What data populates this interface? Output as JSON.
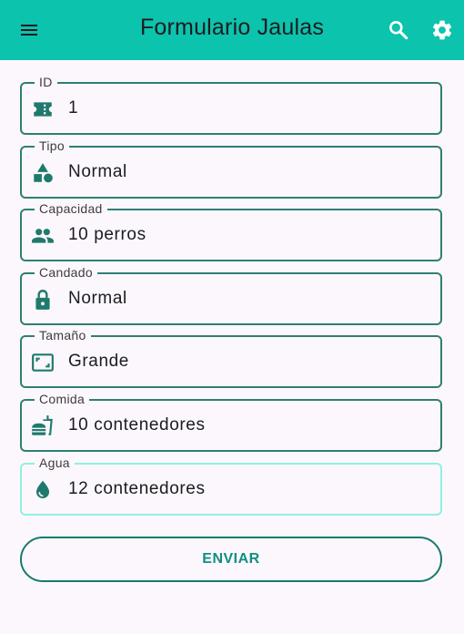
{
  "appbar": {
    "title": "Formulario Jaulas",
    "icons": {
      "menu": "menu-icon",
      "search": "search-icon",
      "settings": "gear-icon"
    }
  },
  "fields": [
    {
      "label": "ID",
      "value": "1",
      "icon": "ticket-icon"
    },
    {
      "label": "Tipo",
      "value": "Normal",
      "icon": "shapes-icon"
    },
    {
      "label": "Capacidad",
      "value": "10 perros",
      "icon": "people-icon"
    },
    {
      "label": "Candado",
      "value": "Normal",
      "icon": "lock-icon"
    },
    {
      "label": "Tamaño",
      "value": "Grande",
      "icon": "aspect-ratio-icon"
    },
    {
      "label": "Comida",
      "value": "10 contenedores",
      "icon": "fastfood-icon"
    },
    {
      "label": "Agua",
      "value": "12 contenedores",
      "icon": "water-drop-icon"
    }
  ],
  "submit_label": "ENVIAR",
  "colors": {
    "appbar": "#0cc3ad",
    "background": "#fcf7fc",
    "field_border": "#2f7f74",
    "field_border_active": "#8ef0e2",
    "icon": "#1e7a6d",
    "button_text": "#0f8f82"
  }
}
